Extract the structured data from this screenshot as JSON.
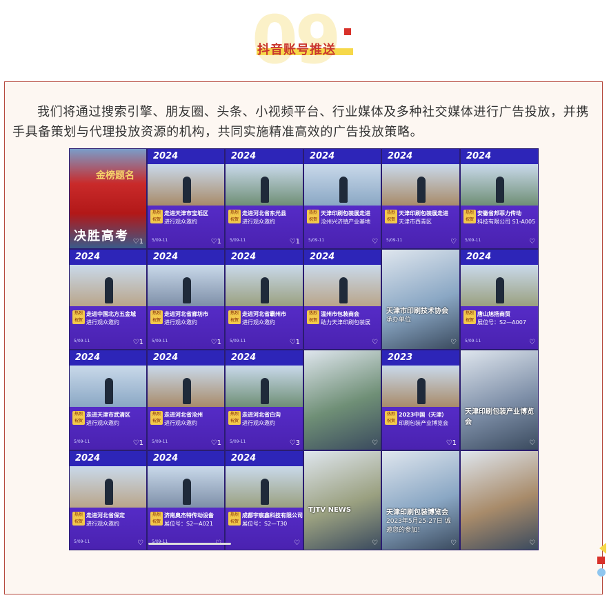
{
  "header": {
    "number": "09",
    "title": "抖音账号推送"
  },
  "paragraph": "我们将通过搜索引擎、朋友圈、头条、小视频平台、行业媒体及多种社交媒体进行广告投放，并携手具备策划与代理投放资源的机构，共同实施精准高效的广告投放策略。",
  "colors": {
    "accent": "#c9362e",
    "highlight": "#f6d84a",
    "panel_border": "#b64a3e",
    "promo": "#4a2fd0"
  },
  "tiles": [
    {
      "col": 0,
      "row": 0,
      "kind": "poster",
      "label": "决胜高考",
      "sub": "金榜题名",
      "like": "1"
    },
    {
      "col": 1,
      "row": 0,
      "kind": "promo",
      "year": "2024",
      "caption": "走进天津市宝坻区",
      "caption2": "进行观众邀约",
      "like": "1",
      "date": "5/09-11"
    },
    {
      "col": 2,
      "row": 0,
      "kind": "promo",
      "year": "2024",
      "caption": "走进河北省东光县",
      "caption2": "进行观众邀约",
      "like": "1",
      "date": "5/09-11"
    },
    {
      "col": 0,
      "row": 1,
      "kind": "promo",
      "year": "2024",
      "caption": "走进中国北方五金城",
      "caption2": "进行观众邀约",
      "like": "1",
      "date": "5/09-11"
    },
    {
      "col": 1,
      "row": 1,
      "kind": "promo",
      "year": "2024",
      "caption": "走进河北省廊坊市",
      "caption2": "进行观众邀约",
      "like": "1",
      "date": "5/09-11"
    },
    {
      "col": 2,
      "row": 1,
      "kind": "promo",
      "year": "2024",
      "caption": "走进河北省霸州市",
      "caption2": "进行观众邀约",
      "like": "1",
      "date": "5/09-11"
    },
    {
      "col": 0,
      "row": 2,
      "kind": "promo",
      "year": "2024",
      "caption": "走进天津市武清区",
      "caption2": "进行观众邀约",
      "like": "1",
      "date": "5/09-11"
    },
    {
      "col": 1,
      "row": 2,
      "kind": "promo",
      "year": "2024",
      "caption": "走进河北省沧州",
      "caption2": "进行观众邀约",
      "like": "1",
      "date": "5/09-11"
    },
    {
      "col": 2,
      "row": 2,
      "kind": "promo",
      "year": "2024",
      "caption": "走进河北省白沟",
      "caption2": "进行观众邀约",
      "like": "3",
      "date": "5/09-11"
    },
    {
      "col": 0,
      "row": 3,
      "kind": "promo",
      "year": "2024",
      "caption": "走进河北省保定",
      "caption2": "进行观众邀约",
      "like": "",
      "date": "5/09-11"
    },
    {
      "col": 1,
      "row": 3,
      "kind": "promo",
      "year": "2024",
      "caption": "济南奥杰特传动设备",
      "caption2": "展位号：S2—A021",
      "like": "",
      "date": "5/09-11"
    },
    {
      "col": 2,
      "row": 3,
      "kind": "promo",
      "year": "2024",
      "caption": "成都宇宸鑫科技有限公司",
      "caption2": "展位号：S2—T30",
      "like": "",
      "date": ""
    },
    {
      "col": 3,
      "row": 0,
      "kind": "promo",
      "year": "2024",
      "caption": "天津印刷包装展走进",
      "caption2": "沧州兴济镇产业基地",
      "like": "",
      "date": "5/09-11"
    },
    {
      "col": 4,
      "row": 0,
      "kind": "promo",
      "year": "2024",
      "caption": "天津印刷包装展走进",
      "caption2": "天津市西青区",
      "like": "",
      "date": "5/09-11"
    },
    {
      "col": 5,
      "row": 0,
      "kind": "promo",
      "year": "2024",
      "caption": "安徽省邦菲力传动",
      "caption2": "科技有限公司 S1-A005",
      "like": "",
      "date": "5/09-11"
    },
    {
      "col": 3,
      "row": 1,
      "kind": "promo",
      "year": "2024",
      "caption": "温州市包装商会",
      "caption2": "助力天津印刷包装展",
      "like": "",
      "date": ""
    },
    {
      "col": 4,
      "row": 1,
      "kind": "photo",
      "caption": "天津市印刷技术协会",
      "caption2": "承办单位",
      "like": "",
      "date": ""
    },
    {
      "col": 5,
      "row": 1,
      "kind": "promo",
      "year": "2024",
      "caption": "唐山旭扬商贸",
      "caption2": "展位号：S2—A007",
      "like": "",
      "date": "5/09-11"
    },
    {
      "col": 3,
      "row": 2,
      "kind": "photo",
      "caption": "",
      "caption2": "",
      "like": "",
      "date": ""
    },
    {
      "col": 4,
      "row": 2,
      "kind": "promo",
      "year": "2023",
      "caption": "2023中国（天津）",
      "caption2": "印刷包装产业博览会",
      "like": "1",
      "date": ""
    },
    {
      "col": 5,
      "row": 2,
      "kind": "photo",
      "caption": "天津印刷包装产业博览会",
      "caption2": "",
      "like": "",
      "date": ""
    },
    {
      "col": 3,
      "row": 3,
      "kind": "photo",
      "caption": "TJTV NEWS",
      "caption2": "",
      "like": "",
      "date": ""
    },
    {
      "col": 4,
      "row": 3,
      "kind": "photo",
      "caption": "天津印刷包装博览会",
      "caption2": "2023年5月25-27日 诚邀您的参加！",
      "like": "",
      "date": ""
    },
    {
      "col": 5,
      "row": 3,
      "kind": "photo",
      "caption": "",
      "caption2": "",
      "like": "",
      "date": ""
    }
  ]
}
